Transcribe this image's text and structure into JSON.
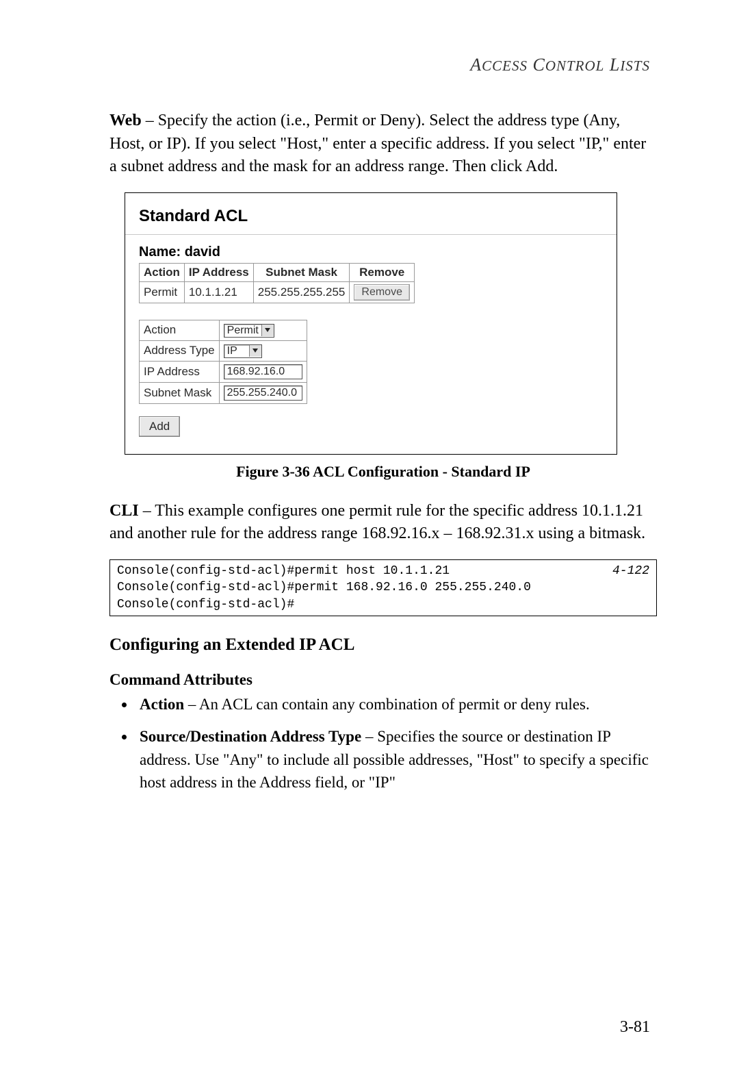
{
  "header": {
    "title_smallcaps": "Access Control Lists"
  },
  "web_para": {
    "lead": "Web",
    "text": " – Specify the action (i.e., Permit or Deny). Select the address type (Any, Host, or IP). If you select \"Host,\" enter a specific address. If you select \"IP,\" enter a subnet address and the mask for an address range. Then click Add."
  },
  "ui": {
    "title": "Standard ACL",
    "name_label": "Name: ",
    "name_value": "david",
    "table": {
      "headers": [
        "Action",
        "IP Address",
        "Subnet Mask",
        "Remove"
      ],
      "row": {
        "action": "Permit",
        "ip": "10.1.1.21",
        "mask": "255.255.255.255",
        "remove": "Remove"
      }
    },
    "form": {
      "action_label": "Action",
      "action_value": "Permit",
      "address_type_label": "Address Type",
      "address_type_value": "IP",
      "ip_label": "IP Address",
      "ip_value": "168.92.16.0",
      "mask_label": "Subnet Mask",
      "mask_value": "255.255.240.0"
    },
    "add_button": "Add"
  },
  "figure_caption": "Figure 3-36  ACL Configuration - Standard IP",
  "cli_para": {
    "lead": "CLI",
    "text": " – This example configures one permit rule for the specific address 10.1.1.21 and another rule for the address range 168.92.16.x – 168.92.31.x using a bitmask."
  },
  "cli": {
    "ref": "4-122",
    "line1": "Console(config-std-acl)#permit host 10.1.1.21",
    "line2": "Console(config-std-acl)#permit 168.92.16.0 255.255.240.0",
    "line3": "Console(config-std-acl)#"
  },
  "section_heading": "Configuring an Extended IP ACL",
  "subsection_heading": "Command Attributes",
  "bullets": [
    {
      "lead": "Action",
      "rest": " – An ACL can contain any combination of permit or deny rules."
    },
    {
      "lead": "Source/Destination Address Type",
      "rest": " – Specifies the source or destination IP address. Use \"Any\" to include all possible addresses, \"Host\" to specify a specific host address in the Address field, or \"IP\""
    }
  ],
  "page_number": "3-81"
}
